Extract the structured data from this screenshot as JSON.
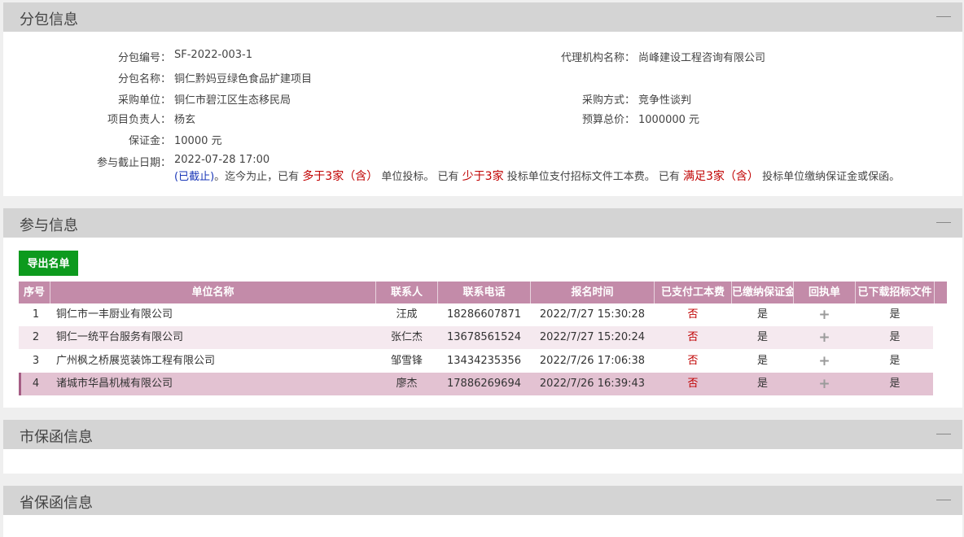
{
  "sections": {
    "subpackage": "分包信息",
    "participation": "参与信息",
    "city_guarantee": "市保函信息",
    "province_guarantee": "省保函信息"
  },
  "info": {
    "code_label": "分包编号：",
    "code": "SF-2022-003-1",
    "agency_label": "代理机构名称：",
    "agency": "尚峰建设工程咨询有限公司",
    "name_label": "分包名称：",
    "name": "铜仁黔妈豆绿色食品扩建项目",
    "purchaser_label": "采购单位：",
    "purchaser": "铜仁市碧江区生态移民局",
    "method_label": "采购方式：",
    "method": "竞争性谈判",
    "manager_label": "项目负责人：",
    "manager": "杨玄",
    "budget_label": "预算总价：",
    "budget": "1000000 元",
    "deposit_label": "保证金：",
    "deposit": "10000 元",
    "deadline_label": "参与截止日期：",
    "deadline": "2022-07-28 17:00",
    "note_closed": "(已截止)",
    "note_p1": "。迄今为止，已有",
    "note_r1": "多于3家（含）",
    "note_p2": "单位投标。 已有",
    "note_r2": "少于3家",
    "note_p3": "投标单位支付招标文件工本费。 已有",
    "note_r3": "满足3家（含）",
    "note_p4": "投标单位缴纳保证金或保函。"
  },
  "export_button": "导出名单",
  "table": {
    "headers": [
      "序号",
      "单位名称",
      "联系人",
      "联系电话",
      "报名时间",
      "已支付工本费",
      "已缴纳保证金",
      "回执单",
      "已下载招标文件"
    ],
    "rows": [
      {
        "no": "1",
        "company": "铜仁市一丰厨业有限公司",
        "contact": "汪成",
        "phone": "18286607871",
        "time": "2022/7/27 15:30:28",
        "fee": "否",
        "deposit": "是",
        "receipt": "+",
        "download": "是"
      },
      {
        "no": "2",
        "company": "铜仁一统平台服务有限公司",
        "contact": "张仁杰",
        "phone": "13678561524",
        "time": "2022/7/27 15:20:24",
        "fee": "否",
        "deposit": "是",
        "receipt": "+",
        "download": "是"
      },
      {
        "no": "3",
        "company": "广州枫之桥展览装饰工程有限公司",
        "contact": "邹雪锋",
        "phone": "13434235356",
        "time": "2022/7/26 17:06:38",
        "fee": "否",
        "deposit": "是",
        "receipt": "+",
        "download": "是"
      },
      {
        "no": "4",
        "company": "诸城市华昌机械有限公司",
        "contact": "廖杰",
        "phone": "17886269694",
        "time": "2022/7/26 16:39:43",
        "fee": "否",
        "deposit": "是",
        "receipt": "+",
        "download": "是"
      }
    ]
  },
  "colors": {
    "header_bg": "#c38ba9",
    "row_alt": "#f5e9ef",
    "row_selected": "#e3c2d2",
    "export_btn": "#0d9a1e",
    "no_text": "#c00000"
  }
}
